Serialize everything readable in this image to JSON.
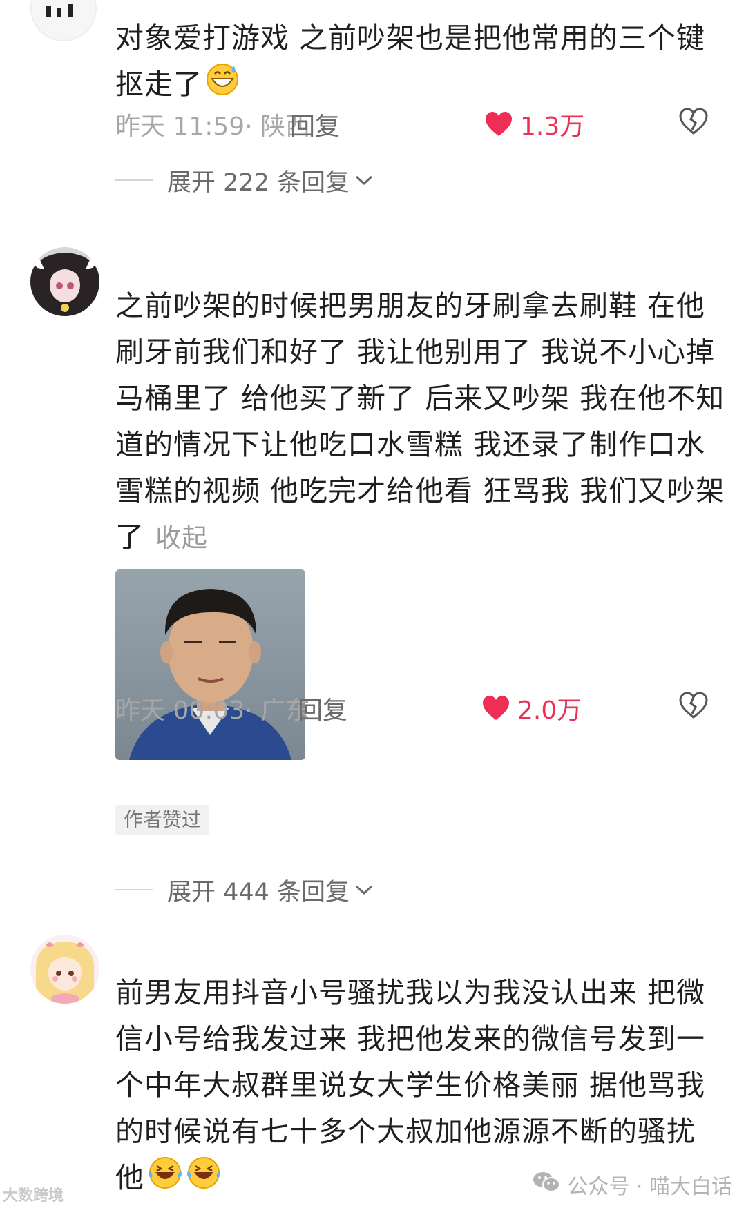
{
  "comments": [
    {
      "text_lines": [
        "对象爱打游戏 之前吵架也是把他常用的三个键",
        "抠走了"
      ],
      "emoji": "grinning-sweat-emoji",
      "time": "昨天 11:59· 陕西",
      "reply_label": "回复",
      "likes": "1.3万",
      "expand_label": "展开 222 条回复"
    },
    {
      "text_lines": [
        "之前吵架的时候把男朋友的牙刷拿去刷鞋 在他",
        "刷牙前我们和好了 我让他别用了 我说不小心掉",
        "马桶里了 给他买了新了 后来又吵架 我在他不知",
        "道的情况下让他吃口水雪糕 我还录了制作口水",
        "雪糕的视频 他吃完才给他看 狂骂我 我们又吵架",
        "了"
      ],
      "collapse_label": "收起",
      "time": "昨天 00:03· 广东",
      "reply_label": "回复",
      "likes": "2.0万",
      "badge": "作者赞过",
      "expand_label": "展开 444 条回复"
    },
    {
      "text_lines": [
        "前男友用抖音小号骚扰我以为我没认出来 把微",
        "信小号给我发过来 我把他发来的微信号发到一",
        "个中年大叔群里说女大学生价格美丽 据他骂我",
        "的时候说有七十多个大叔加他源源不断的骚扰",
        "他"
      ],
      "emoji": "laughing-tears-emoji"
    }
  ],
  "watermark": {
    "right": "公众号 · 喵大白话",
    "left": "大数跨境"
  },
  "colors": {
    "like": "#ee2e54",
    "meta": "#a7a7a7",
    "text": "#1f1f1f"
  }
}
